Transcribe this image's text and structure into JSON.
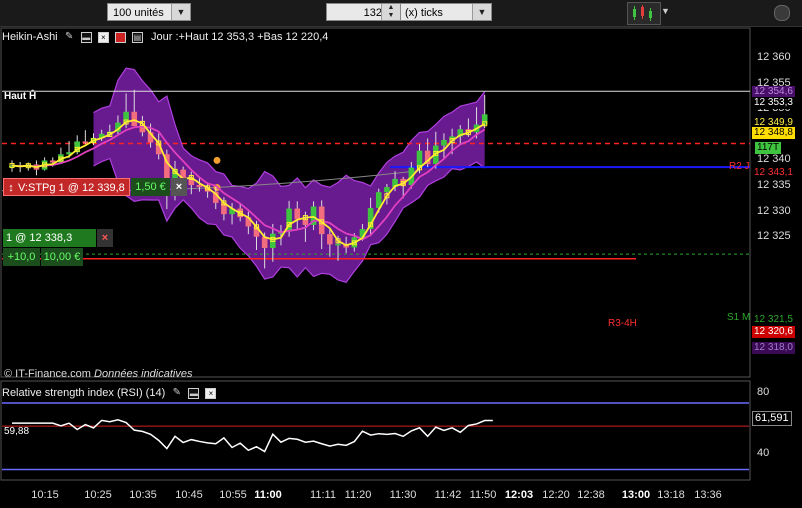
{
  "toolbar": {
    "quantity": "100 unités",
    "ticks_value": "132",
    "ticks_unit": "(x) ticks"
  },
  "chart_header": {
    "chart_type": "Heikin-Ashi",
    "info": "Jour :+Haut 12 353,3 +Bas 12 220,4"
  },
  "main_pane": {
    "haut_label": "Haut Ĥ",
    "copyright": "© IT-Finance.com",
    "disclaimer": "Données indicatives",
    "y_ticks": [
      "12 360",
      "12 355",
      "12 350",
      "12 345",
      "12 340",
      "12 335",
      "12 330",
      "12 325"
    ],
    "level_labels": {
      "haut": "12 353,3",
      "band_top": "12 354,6",
      "yellow": "12 349,9",
      "price": "12 348,8",
      "r2_val": "12 343,1",
      "s1_val": "12 321,5",
      "r3_val": "12 320,6",
      "band_bot": "12 318,0",
      "ticks_tag": "117T",
      "r2": "R2 J",
      "s1": "S1 M",
      "r3": "R3-4H"
    },
    "stop_order": {
      "label": "V:STPg  1 @ 12 339,8",
      "pnl": "1,50 €"
    },
    "position": {
      "label": "1 @ 12 338,3 (RL)",
      "pnl_points": "+10,0",
      "pnl_eur": "10,00 €"
    }
  },
  "rsi_pane": {
    "title": "Relative strength index (RSI) (14)",
    "y_ticks": [
      "80",
      "40"
    ],
    "current_value": "61,591",
    "left_value": "59,88"
  },
  "x_axis": [
    "10:15",
    "10:25",
    "10:35",
    "10:45",
    "10:55",
    "11:00",
    "11:11",
    "11:20",
    "11:30",
    "11:42",
    "11:50",
    "12:03",
    "12:20",
    "12:38",
    "13:00",
    "13:18",
    "13:36"
  ],
  "colors": {
    "bull": "#3ec43e",
    "bear": "#f26d7d",
    "band": "#7a1fa8",
    "rsi_line": "#ffffff",
    "red_level": "#ff2020",
    "blue_level": "#1a1aff"
  },
  "chart_data": {
    "type": "candlestick",
    "ylim": [
      12315,
      12365
    ],
    "candles": [
      {
        "o": 12338.5,
        "h": 12339.8,
        "l": 12337.6,
        "c": 12338.8
      },
      {
        "o": 12338.8,
        "h": 12339.5,
        "l": 12337.5,
        "c": 12338.5
      },
      {
        "o": 12338.5,
        "h": 12339.4,
        "l": 12337.8,
        "c": 12339.0
      },
      {
        "o": 12339.0,
        "h": 12339.8,
        "l": 12336.9,
        "c": 12338.0
      },
      {
        "o": 12338.0,
        "h": 12340.4,
        "l": 12337.8,
        "c": 12339.8
      },
      {
        "o": 12339.8,
        "h": 12340.4,
        "l": 12338.6,
        "c": 12339.4
      },
      {
        "o": 12339.4,
        "h": 12342.3,
        "l": 12339.2,
        "c": 12341.0
      },
      {
        "o": 12341.0,
        "h": 12343.6,
        "l": 12340.3,
        "c": 12341.4
      },
      {
        "o": 12341.4,
        "h": 12344.7,
        "l": 12341.0,
        "c": 12343.5
      },
      {
        "o": 12343.5,
        "h": 12345.7,
        "l": 12343.0,
        "c": 12343.3
      },
      {
        "o": 12343.3,
        "h": 12345.1,
        "l": 12342.8,
        "c": 12344.2
      },
      {
        "o": 12344.2,
        "h": 12345.8,
        "l": 12343.6,
        "c": 12345.0
      },
      {
        "o": 12345.0,
        "h": 12346.8,
        "l": 12344.5,
        "c": 12345.4
      },
      {
        "o": 12345.4,
        "h": 12348.6,
        "l": 12344.8,
        "c": 12347.2
      },
      {
        "o": 12347.2,
        "h": 12352.9,
        "l": 12346.1,
        "c": 12349.3
      },
      {
        "o": 12349.3,
        "h": 12353.6,
        "l": 12347.4,
        "c": 12346.5
      },
      {
        "o": 12346.5,
        "h": 12348.5,
        "l": 12344.5,
        "c": 12345.3
      },
      {
        "o": 12345.3,
        "h": 12347.0,
        "l": 12342.3,
        "c": 12343.3
      },
      {
        "o": 12343.3,
        "h": 12345.1,
        "l": 12340.0,
        "c": 12341.0
      },
      {
        "o": 12341.0,
        "h": 12341.9,
        "l": 12330.3,
        "c": 12334.0
      },
      {
        "o": 12334.0,
        "h": 12339.7,
        "l": 12332.0,
        "c": 12338.0
      },
      {
        "o": 12338.0,
        "h": 12338.6,
        "l": 12335.4,
        "c": 12336.4
      },
      {
        "o": 12336.4,
        "h": 12337.6,
        "l": 12333.2,
        "c": 12335.0
      },
      {
        "o": 12335.0,
        "h": 12336.3,
        "l": 12333.7,
        "c": 12334.6
      },
      {
        "o": 12334.6,
        "h": 12335.5,
        "l": 12332.5,
        "c": 12333.7
      },
      {
        "o": 12333.7,
        "h": 12334.6,
        "l": 12330.3,
        "c": 12331.5
      },
      {
        "o": 12331.5,
        "h": 12332.6,
        "l": 12328.1,
        "c": 12329.3
      },
      {
        "o": 12329.3,
        "h": 12331.5,
        "l": 12327.3,
        "c": 12330.4
      },
      {
        "o": 12330.4,
        "h": 12331.5,
        "l": 12327.9,
        "c": 12328.7
      },
      {
        "o": 12328.7,
        "h": 12329.8,
        "l": 12325.4,
        "c": 12326.9
      },
      {
        "o": 12326.9,
        "h": 12328.0,
        "l": 12322.3,
        "c": 12324.9
      },
      {
        "o": 12324.9,
        "h": 12325.7,
        "l": 12318.7,
        "c": 12322.7
      },
      {
        "o": 12322.7,
        "h": 12327.4,
        "l": 12320.0,
        "c": 12325.5
      },
      {
        "o": 12325.5,
        "h": 12327.2,
        "l": 12323.2,
        "c": 12325.9
      },
      {
        "o": 12325.9,
        "h": 12331.9,
        "l": 12324.9,
        "c": 12330.4
      },
      {
        "o": 12330.4,
        "h": 12331.8,
        "l": 12326.2,
        "c": 12328.3
      },
      {
        "o": 12328.3,
        "h": 12329.8,
        "l": 12323.9,
        "c": 12327.2
      },
      {
        "o": 12327.2,
        "h": 12331.8,
        "l": 12326.2,
        "c": 12330.8
      },
      {
        "o": 12330.8,
        "h": 12332.0,
        "l": 12322.5,
        "c": 12325.4
      },
      {
        "o": 12325.4,
        "h": 12326.5,
        "l": 12321.0,
        "c": 12323.4
      },
      {
        "o": 12323.4,
        "h": 12325.1,
        "l": 12320.2,
        "c": 12323.5
      },
      {
        "o": 12323.5,
        "h": 12324.9,
        "l": 12321.7,
        "c": 12322.8
      },
      {
        "o": 12322.8,
        "h": 12325.6,
        "l": 12322.0,
        "c": 12324.8
      },
      {
        "o": 12324.8,
        "h": 12327.4,
        "l": 12324.1,
        "c": 12326.4
      },
      {
        "o": 12326.4,
        "h": 12332.5,
        "l": 12325.0,
        "c": 12330.5
      },
      {
        "o": 12330.5,
        "h": 12334.3,
        "l": 12329.6,
        "c": 12333.6
      },
      {
        "o": 12333.6,
        "h": 12335.2,
        "l": 12331.2,
        "c": 12334.6
      },
      {
        "o": 12334.6,
        "h": 12337.7,
        "l": 12333.8,
        "c": 12336.2
      },
      {
        "o": 12336.2,
        "h": 12336.6,
        "l": 12332.4,
        "c": 12335.0
      },
      {
        "o": 12335.0,
        "h": 12339.5,
        "l": 12334.3,
        "c": 12338.4
      },
      {
        "o": 12338.4,
        "h": 12343.0,
        "l": 12337.3,
        "c": 12341.7
      },
      {
        "o": 12341.7,
        "h": 12344.1,
        "l": 12338.5,
        "c": 12339.1
      },
      {
        "o": 12339.1,
        "h": 12345.4,
        "l": 12338.2,
        "c": 12342.7
      },
      {
        "o": 12342.7,
        "h": 12345.1,
        "l": 12340.2,
        "c": 12343.8
      },
      {
        "o": 12343.8,
        "h": 12346.0,
        "l": 12341.0,
        "c": 12344.5
      },
      {
        "o": 12344.5,
        "h": 12346.7,
        "l": 12342.9,
        "c": 12345.9
      },
      {
        "o": 12345.9,
        "h": 12348.0,
        "l": 12344.4,
        "c": 12345.3
      },
      {
        "o": 12345.3,
        "h": 12350.2,
        "l": 12344.1,
        "c": 12346.8
      },
      {
        "o": 12346.8,
        "h": 12352.6,
        "l": 12346.1,
        "c": 12348.8
      }
    ],
    "rsi": [
      59.9,
      59.9,
      59.9,
      59.9,
      59.9,
      59.9,
      58.2,
      59.9,
      55.8,
      59.0,
      56.8,
      61.7,
      60.8,
      62.1,
      60.3,
      55.4,
      54.6,
      52.7,
      48.8,
      43.5,
      51.4,
      47.4,
      49.3,
      48.1,
      47.2,
      46.6,
      50.4,
      44.2,
      47.0,
      42.4,
      44.7,
      41.6,
      52.8,
      47.6,
      50.1,
      49.5,
      47.6,
      48.3,
      46.6,
      45.1,
      46.3,
      45.6,
      48.0,
      54.7,
      52.2,
      53.1,
      52.7,
      53.2,
      51.4,
      54.9,
      56.9,
      51.4,
      57.3,
      55.2,
      56.9,
      54.0,
      58.4,
      59.4,
      61.6,
      61.6
    ]
  }
}
